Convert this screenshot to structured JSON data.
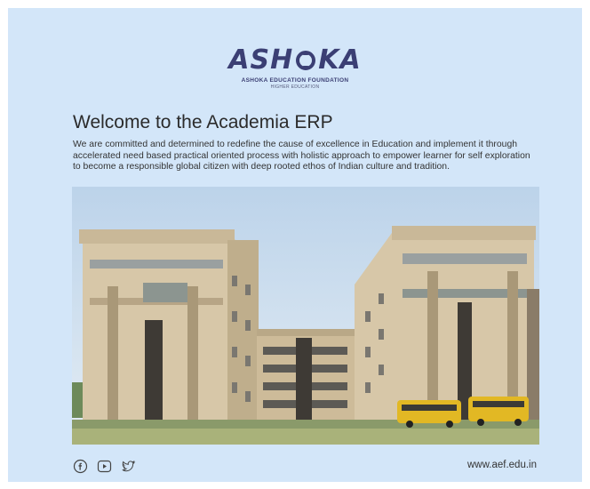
{
  "brand": {
    "logo_text_left": "ASH",
    "logo_text_right": "KA",
    "foundation": "ASHOKA EDUCATION FOUNDATION",
    "division": "HIGHER EDUCATION",
    "color": "#3b3f74"
  },
  "welcome": {
    "title": "Welcome to the Academia ERP",
    "description": "We are committed and determined to redefine the cause of excellence in Education and implement it through accelerated need based practical oriented process with holistic approach to empower learner for self exploration to become a responsible global citizen with deep rooted ethos of Indian culture and tradition."
  },
  "footer": {
    "social_icons": [
      "facebook-icon",
      "youtube-icon",
      "twitter-icon"
    ],
    "website": "www.aef.edu.in"
  },
  "colors": {
    "panel_background": "#d3e6f9"
  }
}
